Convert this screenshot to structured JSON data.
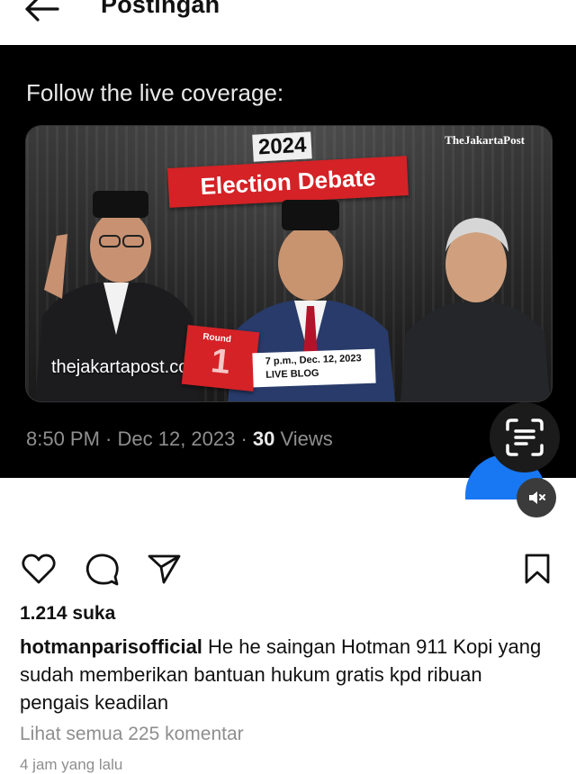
{
  "header": {
    "title": "Postingan",
    "back_icon": "arrow-left-icon"
  },
  "tweet": {
    "text": "Follow the live coverage:",
    "card": {
      "publisher_logo": "TheJakartaPost",
      "year": "2024",
      "event": "Election Debate",
      "site": "thejakartapost.com",
      "round_label": "Round",
      "round_number": "1",
      "schedule_date": "7 p.m., Dec. 12, 2023",
      "schedule_type": "LIVE BLOG"
    },
    "time": "8:50 PM · Dec 12, 2023 · ",
    "views_count": "30",
    "views_label": " Views"
  },
  "overlay": {
    "scan_icon": "scan-text-icon",
    "mute_icon": "speaker-muted-icon"
  },
  "actions": {
    "like_icon": "heart-icon",
    "comment_icon": "comment-bubble-icon",
    "share_icon": "paper-plane-icon",
    "save_icon": "bookmark-icon"
  },
  "post": {
    "likes": "1.214 suka",
    "username": "hotmanparisofficial",
    "caption": "He he saingan Hotman 911 Kopi yang sudah memberikan bantuan hukum gratis kpd ribuan pengais keadilan",
    "view_comments": "Lihat semua 225 komentar",
    "time_ago": "4 jam yang lalu"
  },
  "colors": {
    "accent_red": "#d42226",
    "brand_blue": "#1877f2",
    "text_muted": "#8e8e8e"
  }
}
